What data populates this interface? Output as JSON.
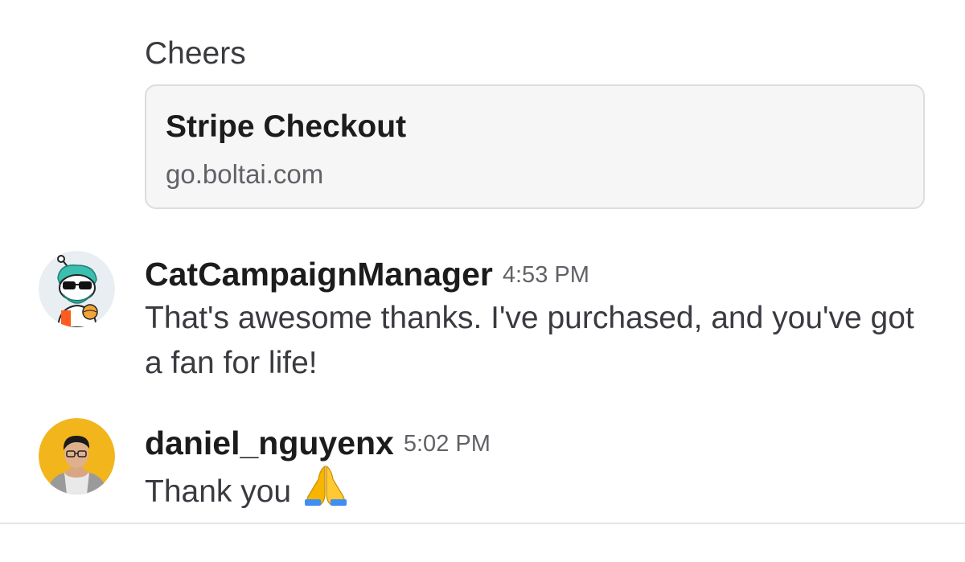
{
  "previous_message": {
    "text": "Cheers"
  },
  "link_preview": {
    "title": "Stripe Checkout",
    "domain": "go.boltai.com"
  },
  "messages": [
    {
      "username": "CatCampaignManager",
      "timestamp": "4:53 PM",
      "text": "That's awesome thanks. I've purchased, and you've got a fan for life!",
      "avatar_icon": "cartoon-sunglasses-avatar",
      "avatar_bg": "#e8eef2"
    },
    {
      "username": "daniel_nguyenx",
      "timestamp": "5:02 PM",
      "text": "Thank you",
      "emoji": "folded-hands-emoji",
      "avatar_icon": "person-photo-avatar",
      "avatar_bg": "#f2b51c"
    }
  ],
  "colors": {
    "text_primary": "#1d1c1d",
    "text_secondary": "#616267",
    "card_bg": "#f6f6f7",
    "card_border": "#dcdde0"
  }
}
